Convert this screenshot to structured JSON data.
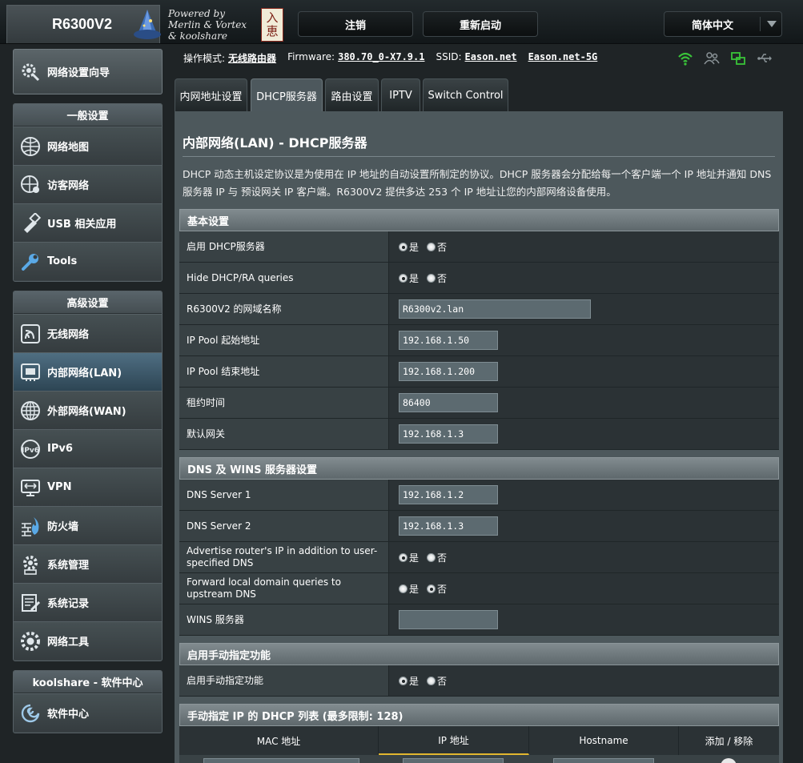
{
  "header": {
    "model": "R6300V2",
    "logo_lines": [
      "Powered by",
      "Merlin & Vortex",
      "& koolshare"
    ],
    "seal_chars": [
      "入",
      "恵"
    ],
    "logout_label": "注销",
    "reboot_label": "重新启动",
    "language_label": "简体中文"
  },
  "status": {
    "mode_label": "操作模式:",
    "mode_value": "无线路由器",
    "firmware_label": "Firmware:",
    "firmware_value": "380.70_0-X7.9.1",
    "ssid_label": "SSID:",
    "ssid_1": "Eason.net",
    "ssid_2": "Eason.net-5G",
    "icons": [
      "wifi-signal-icon",
      "clients-icon",
      "network-map-icon",
      "usb-icon"
    ],
    "colors": {
      "wifi": "#39c339",
      "inactive": "#8a9397"
    }
  },
  "sidebar": {
    "wizard_label": "网络设置向导",
    "general": {
      "heading": "一般设置",
      "items": [
        {
          "label": "网络地图",
          "icon": "network-map-icon"
        },
        {
          "label": "访客网络",
          "icon": "guest-network-icon"
        },
        {
          "label": "USB 相关应用",
          "icon": "usb-app-icon"
        },
        {
          "label": "Tools",
          "icon": "wrench-icon"
        }
      ]
    },
    "advanced": {
      "heading": "高级设置",
      "items": [
        {
          "label": "无线网络",
          "icon": "wireless-icon"
        },
        {
          "label": "内部网络(LAN)",
          "icon": "lan-icon",
          "active": true
        },
        {
          "label": "外部网络(WAN)",
          "icon": "wan-globe-icon"
        },
        {
          "label": "IPv6",
          "icon": "ipv6-icon"
        },
        {
          "label": "VPN",
          "icon": "vpn-icon"
        },
        {
          "label": "防火墙",
          "icon": "firewall-icon"
        },
        {
          "label": "系统管理",
          "icon": "admin-gear-icon"
        },
        {
          "label": "系统记录",
          "icon": "system-log-icon"
        },
        {
          "label": "网络工具",
          "icon": "network-tools-icon"
        }
      ]
    },
    "koolshare": {
      "heading": "koolshare - 软件中心",
      "items": [
        {
          "label": "软件中心",
          "icon": "software-center-icon"
        }
      ]
    }
  },
  "tabs": [
    {
      "label": "内网地址设置"
    },
    {
      "label": "DHCP服务器",
      "active": true
    },
    {
      "label": "路由设置"
    },
    {
      "label": "IPTV"
    },
    {
      "label": "Switch Control"
    }
  ],
  "page": {
    "title": "内部网络(LAN) - DHCP服务器",
    "description": "DHCP 动态主机设定协议是为使用在 IP 地址的自动设置所制定的协议。DHCP 服务器会分配给每一个客户端一个 IP 地址并通知 DNS 服务器 IP 与 预设网关 IP 客户端。R6300V2 提供多达 253 个 IP 地址让您的内部网络设备使用。"
  },
  "radio_labels": {
    "yes": "是",
    "no": "否"
  },
  "basic": {
    "heading": "基本设置",
    "enable_dhcp": {
      "label": "启用 DHCP服务器",
      "value": "yes"
    },
    "hide_dhcp": {
      "label": "Hide DHCP/RA queries",
      "value": "yes"
    },
    "domain_name": {
      "label": "R6300V2 的网域名称",
      "value": "R6300v2.lan"
    },
    "pool_start": {
      "label": "IP Pool 起始地址",
      "value": "192.168.1.50"
    },
    "pool_end": {
      "label": "IP Pool 结束地址",
      "value": "192.168.1.200"
    },
    "lease_time": {
      "label": "租约时间",
      "value": "86400"
    },
    "gateway": {
      "label": "默认网关",
      "value": "192.168.1.3"
    }
  },
  "dns": {
    "heading": "DNS 及 WINS 服务器设置",
    "dns1": {
      "label": "DNS Server 1",
      "value": "192.168.1.2"
    },
    "dns2": {
      "label": "DNS Server 2",
      "value": "192.168.1.3"
    },
    "advertise": {
      "label": "Advertise router's IP in addition to user-specified DNS",
      "value": "yes"
    },
    "forward": {
      "label": "Forward local domain queries to upstream DNS",
      "value": "no"
    },
    "wins": {
      "label": "WINS 服务器",
      "value": ""
    }
  },
  "manual": {
    "heading": "启用手动指定功能",
    "enable": {
      "label": "启用手动指定功能",
      "value": "yes"
    }
  },
  "dhcp_list": {
    "heading": "手动指定 IP 的 DHCP 列表 (最多限制: 128)",
    "columns": [
      "MAC 地址",
      "IP 地址",
      "Hostname",
      "添加 / 移除"
    ]
  }
}
